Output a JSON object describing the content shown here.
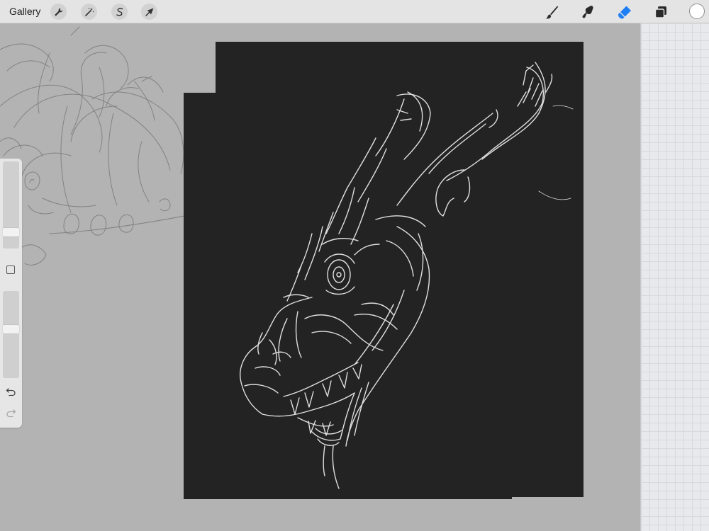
{
  "topbar": {
    "gallery_label": "Gallery",
    "left_tools": [
      {
        "name": "actions",
        "icon": "wrench-icon"
      },
      {
        "name": "adjustments",
        "icon": "magic-wand-icon"
      },
      {
        "name": "selection",
        "icon": "selection-s-icon"
      },
      {
        "name": "transform",
        "icon": "transform-arrow-icon"
      }
    ],
    "right_tools": [
      {
        "name": "brush",
        "icon": "brush-icon",
        "active": false
      },
      {
        "name": "smudge",
        "icon": "smudge-icon",
        "active": false
      },
      {
        "name": "eraser",
        "icon": "eraser-icon",
        "active": true
      },
      {
        "name": "layers",
        "icon": "layers-icon",
        "active": false
      }
    ],
    "current_color": "#ffffff",
    "active_tool_color": "#1e7ff5"
  },
  "sidebar": {
    "brush_size_level": 0.78,
    "opacity_level": 0.57,
    "icons": [
      "modify-square-icon",
      "undo-icon",
      "redo-icon"
    ]
  },
  "canvas": {
    "background": "#b3b3b3",
    "artwork_background": "#232323",
    "stroke_color": "#f0f0f0",
    "sketch_color": "#7d7d7d"
  }
}
